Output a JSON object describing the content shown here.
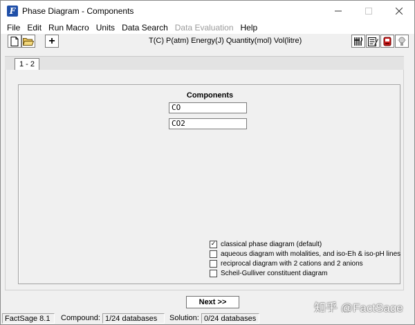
{
  "window": {
    "title": "Phase Diagram - Components",
    "icon": "factsage-f-icon",
    "controls": [
      "minimize-icon",
      "maximize-icon",
      "close-icon"
    ]
  },
  "menu": [
    "File",
    "Edit",
    "Run Macro",
    "Units",
    "Data Search",
    "Data Evaluation",
    "Help"
  ],
  "menu_disabled": [
    "Data Evaluation"
  ],
  "toolbar": {
    "left_buttons": [
      "new-document-icon",
      "open-folder-icon",
      "add-icon"
    ],
    "add_label": "+",
    "units": "T(C)  P(atm)  Energy(J)  Quantity(mol)  Vol(litre)",
    "right_buttons": [
      "fork-knife-icon",
      "notepad-icon",
      "red-tool-icon",
      "bulb-icon"
    ]
  },
  "tabs": [
    {
      "label": "1 - 2",
      "selected": true
    }
  ],
  "components": {
    "heading": "Components",
    "fields": [
      "CO",
      "CO2"
    ]
  },
  "options": [
    {
      "label": "classical phase diagram (default)",
      "checked": true
    },
    {
      "label": "aqueous diagram with molalities, and iso-Eh & iso-pH lines",
      "checked": false
    },
    {
      "label": "reciprocal diagram with 2 cations and 2 anions",
      "checked": false
    },
    {
      "label": "Scheil-Gulliver constituent diagram",
      "checked": false
    }
  ],
  "next_button": "Next >>",
  "watermark": "知乎 @FactSage",
  "status": {
    "version": "FactSage 8.1",
    "compound_label": "Compound:",
    "compound_value": "1/24 databases",
    "solution_label": "Solution:",
    "solution_value": "0/24 databases"
  },
  "colors": {
    "window_bg": "#f0f0f0",
    "title_bg": "#ffffff",
    "app_icon": "#1f4fa8"
  }
}
